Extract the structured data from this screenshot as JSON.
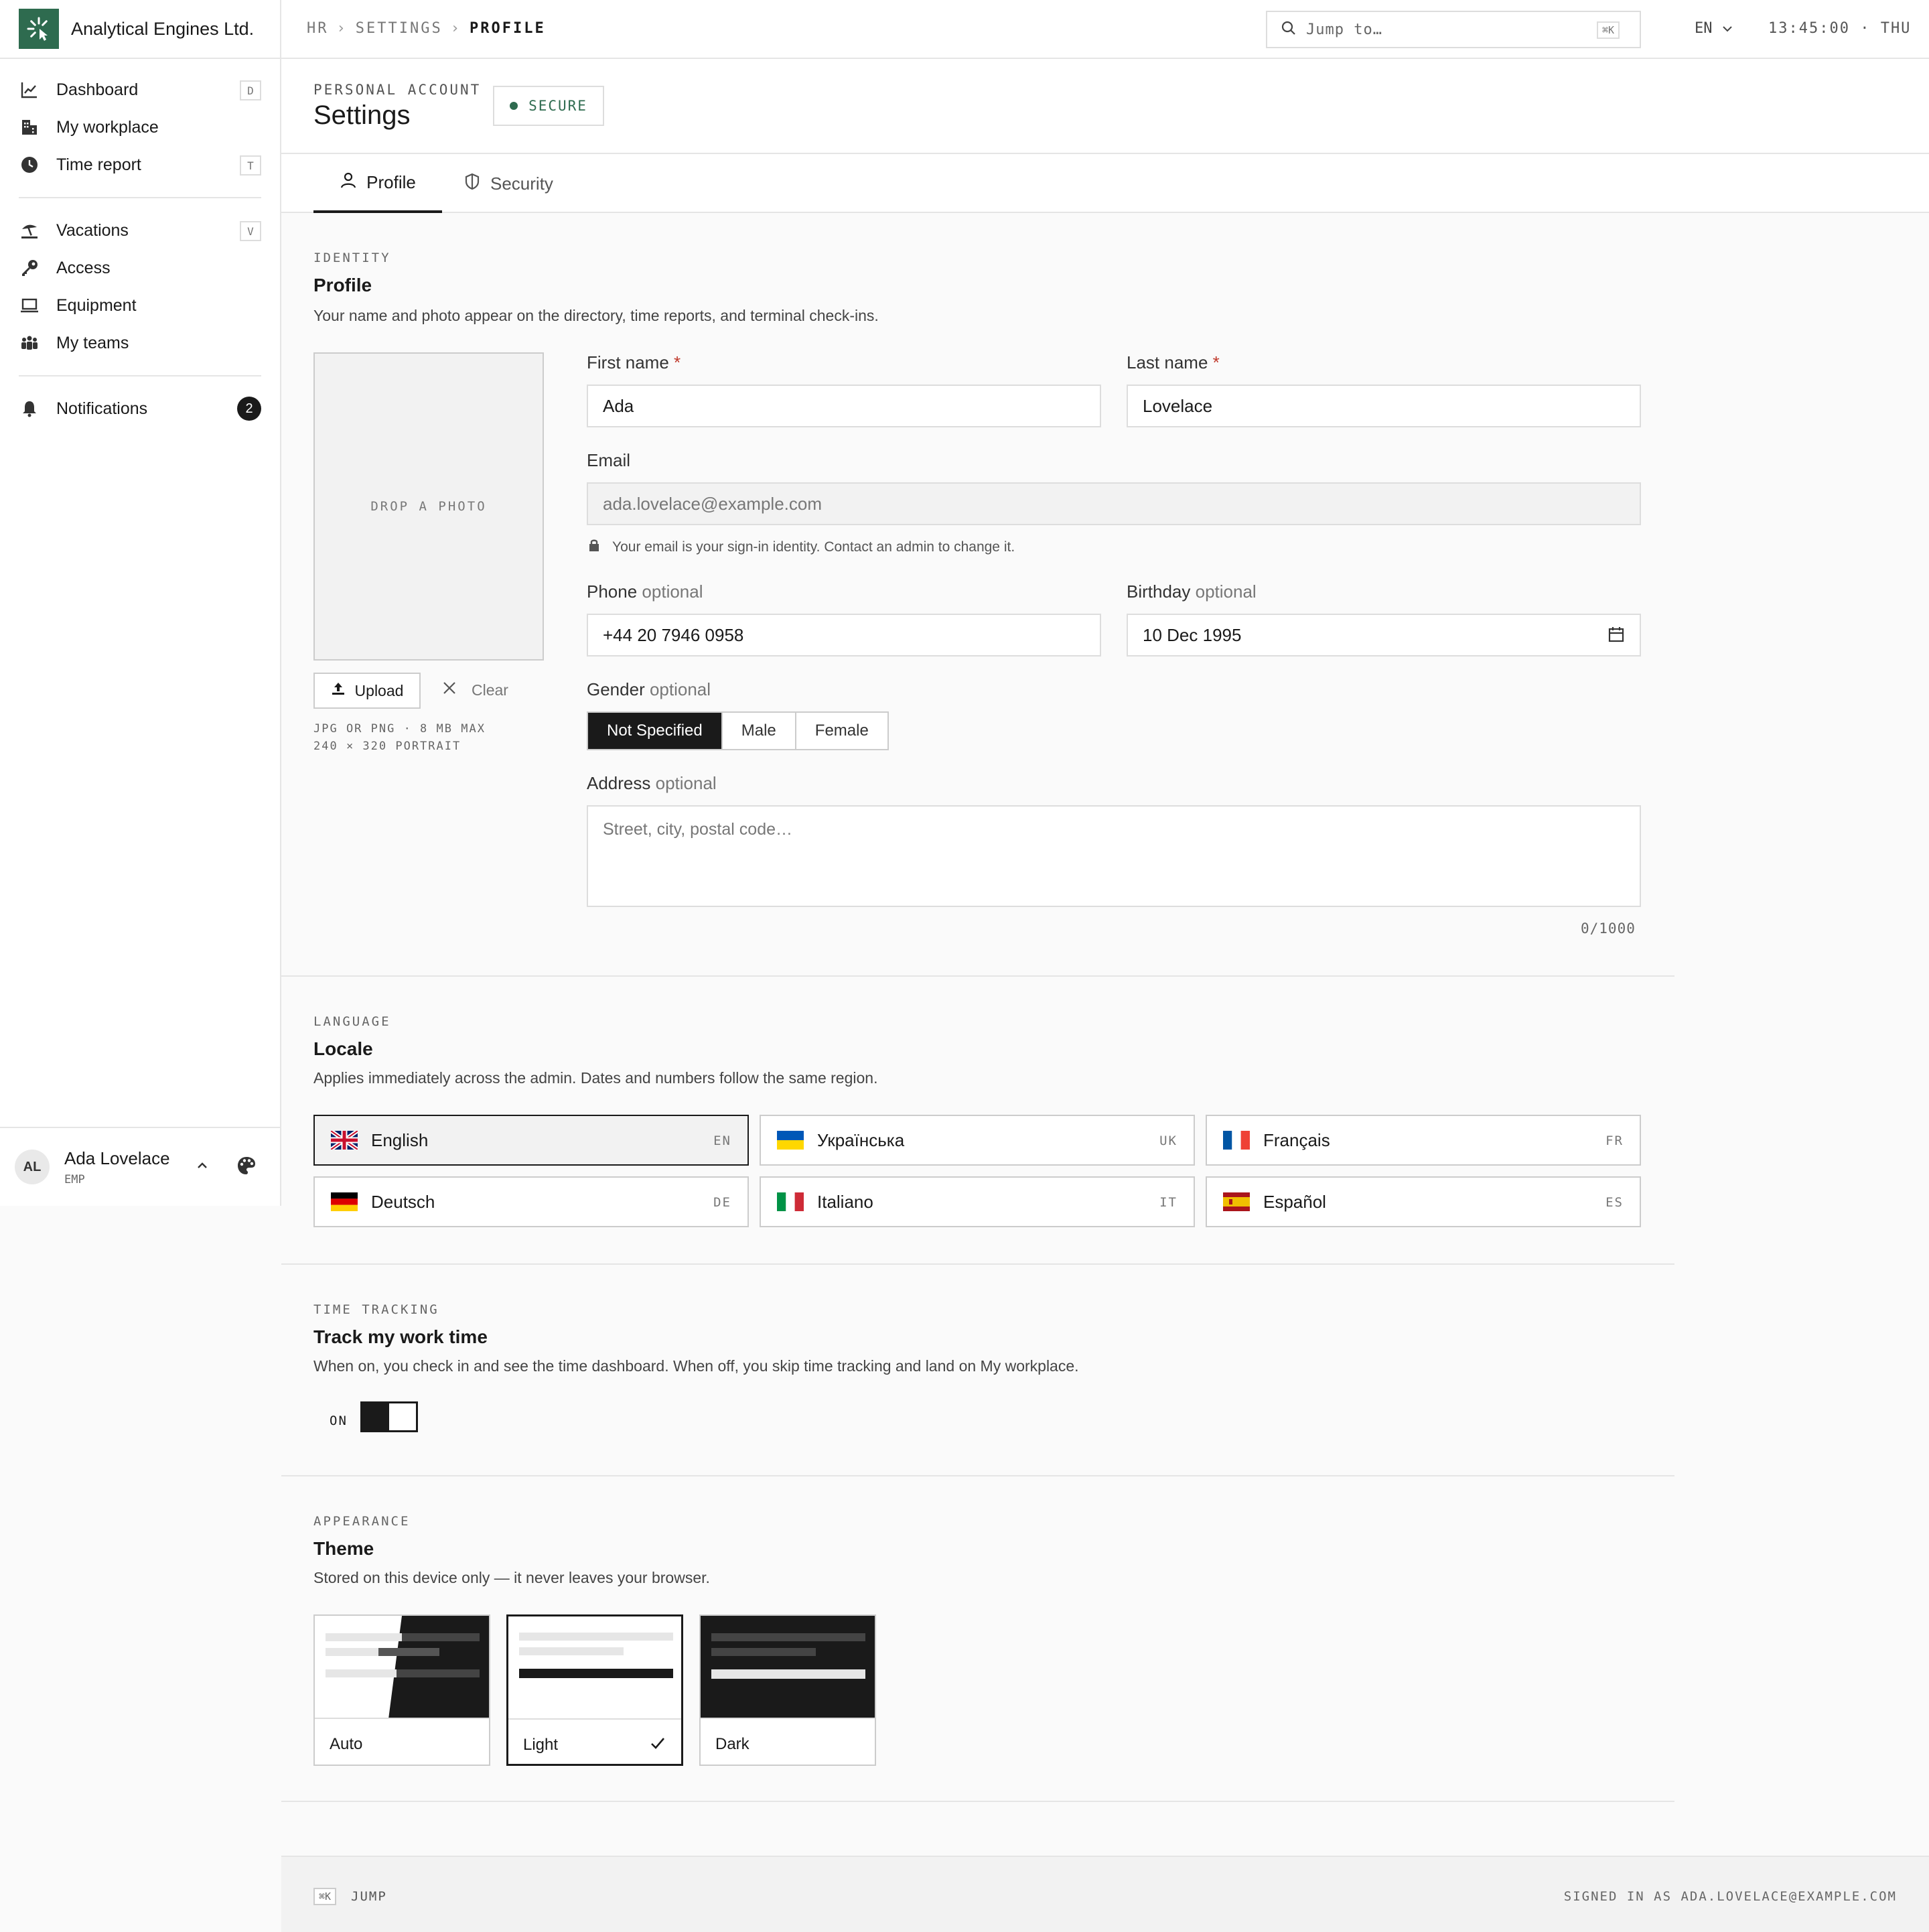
{
  "brand": {
    "name": "Analytical Engines Ltd."
  },
  "sidebar": {
    "items": [
      {
        "label": "Dashboard",
        "key": "D",
        "icon": "chart-line-icon"
      },
      {
        "label": "My workplace",
        "key": "",
        "icon": "building-icon"
      },
      {
        "label": "Time report",
        "key": "T",
        "icon": "clock-icon"
      },
      {
        "label": "Vacations",
        "key": "V",
        "icon": "beach-umbrella-icon"
      },
      {
        "label": "Access",
        "key": "",
        "icon": "key-icon"
      },
      {
        "label": "Equipment",
        "key": "",
        "icon": "laptop-icon"
      },
      {
        "label": "My teams",
        "key": "",
        "icon": "team-icon"
      },
      {
        "label": "Notifications",
        "badge": "2",
        "icon": "bell-icon"
      }
    ],
    "user": {
      "initials": "AL",
      "name": "Ada Lovelace",
      "role": "EMP"
    }
  },
  "topbar": {
    "breadcrumb": [
      "HR",
      "SETTINGS",
      "PROFILE"
    ],
    "search_placeholder": "Jump to…",
    "search_shortcut": "⌘K",
    "language": "EN",
    "clock": "13:45:00 · THU"
  },
  "header": {
    "eyebrow": "PERSONAL ACCOUNT",
    "title": "Settings",
    "status": "SECURE"
  },
  "tabs": [
    {
      "label": "Profile",
      "active": true
    },
    {
      "label": "Security",
      "active": false
    }
  ],
  "identity": {
    "label": "IDENTITY",
    "title": "Profile",
    "desc": "Your name and photo appear on the directory, time reports, and terminal check-ins.",
    "photo_placeholder": "DROP A PHOTO",
    "upload_label": "Upload",
    "clear_label": "Clear",
    "photo_hint_1": "JPG OR PNG · 8 MB MAX",
    "photo_hint_2": "240 × 320 PORTRAIT",
    "first_name_label": "First name",
    "first_name": "Ada",
    "last_name_label": "Last name",
    "last_name": "Lovelace",
    "required_mark": "*",
    "email_label": "Email",
    "email": "ada.lovelace@example.com",
    "email_hint": "Your email is your sign-in identity. Contact an admin to change it.",
    "phone_label": "Phone",
    "phone": "+44 20 7946 0958",
    "birthday_label": "Birthday",
    "birthday": "10 Dec 1995",
    "optional": "optional",
    "gender_label": "Gender",
    "gender_options": [
      "Not Specified",
      "Male",
      "Female"
    ],
    "gender_selected": "Not Specified",
    "address_label": "Address",
    "address_placeholder": "Street, city, postal code…",
    "address_counter": "0/1000"
  },
  "language": {
    "label": "LANGUAGE",
    "title": "Locale",
    "desc": "Applies immediately across the admin. Dates and numbers follow the same region.",
    "options": [
      {
        "name": "English",
        "code": "EN",
        "selected": true
      },
      {
        "name": "Українська",
        "code": "UK",
        "selected": false
      },
      {
        "name": "Français",
        "code": "FR",
        "selected": false
      },
      {
        "name": "Deutsch",
        "code": "DE",
        "selected": false
      },
      {
        "name": "Italiano",
        "code": "IT",
        "selected": false
      },
      {
        "name": "Español",
        "code": "ES",
        "selected": false
      }
    ]
  },
  "time_tracking": {
    "label": "TIME TRACKING",
    "title": "Track my work time",
    "desc": "When on, you check in and see the time dashboard. When off, you skip time tracking and land on My workplace.",
    "state": "ON"
  },
  "appearance": {
    "label": "APPEARANCE",
    "title": "Theme",
    "desc": "Stored on this device only — it never leaves your browser.",
    "options": [
      {
        "name": "Auto",
        "selected": false
      },
      {
        "name": "Light",
        "selected": true
      },
      {
        "name": "Dark",
        "selected": false
      }
    ]
  },
  "footer": {
    "shortcut": "⌘K",
    "jump_label": "JUMP",
    "signed_in": "SIGNED IN AS ADA.LOVELACE@EXAMPLE.COM"
  },
  "colors": {
    "accent": "#2e6b4f",
    "ink": "#1a1a1a",
    "required": "#c0392b"
  }
}
